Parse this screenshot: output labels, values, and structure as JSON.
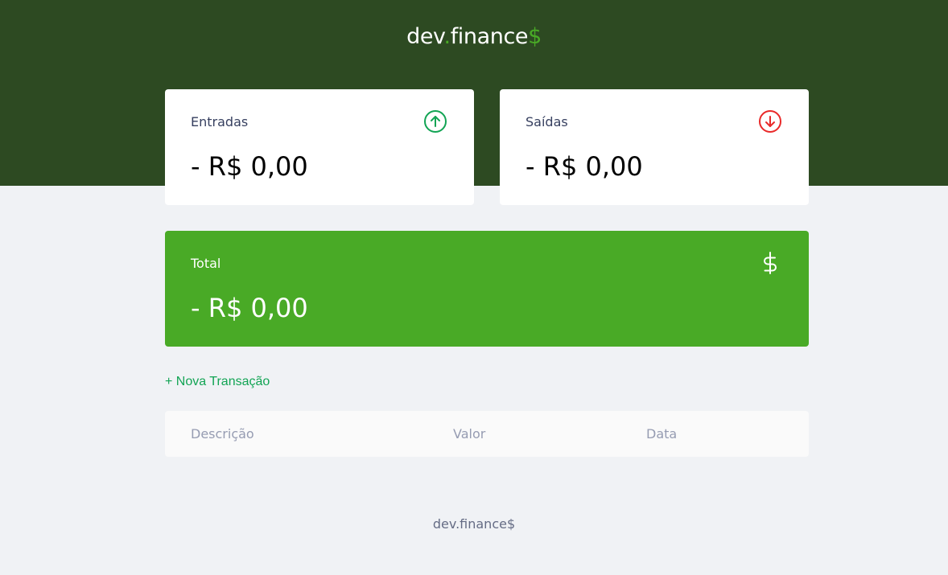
{
  "header": {
    "logo_main": "dev",
    "logo_dot": ".",
    "logo_word": "finance",
    "logo_symbol": "$"
  },
  "cards": {
    "income": {
      "label": "Entradas",
      "value": "- R$ 0,00",
      "icon": "arrow-up-circle-icon",
      "icon_color": "#12a454"
    },
    "expense": {
      "label": "Saídas",
      "value": "- R$ 0,00",
      "icon": "arrow-down-circle-icon",
      "icon_color": "#e92929"
    },
    "total": {
      "label": "Total",
      "value": "- R$ 0,00",
      "icon": "dollar-icon",
      "bg_color": "#49aa26"
    }
  },
  "actions": {
    "new_transaction": "+ Nova Transação"
  },
  "table": {
    "columns": [
      "Descrição",
      "Valor",
      "Data"
    ]
  },
  "footer": {
    "text": "dev.finance$"
  },
  "colors": {
    "header_bg": "#2d4a22",
    "accent": "#49aa26",
    "page_bg": "#f0f2f5"
  }
}
